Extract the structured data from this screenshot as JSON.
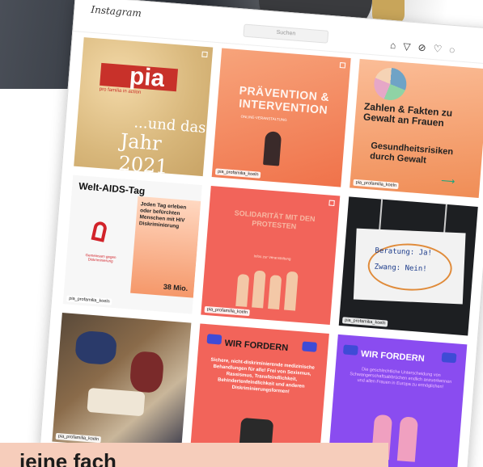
{
  "app": {
    "name": "Instagram",
    "search_placeholder": "Suchen"
  },
  "nav_icons": [
    "home-icon",
    "direct-icon",
    "explore-icon",
    "heart-icon",
    "profile-icon"
  ],
  "bottom_caption": "ieine fach",
  "posts": [
    {
      "lines": [
        "pia",
        "pro familia in action",
        "...und das",
        "Jahr 2021"
      ],
      "tag": ""
    },
    {
      "lines": [
        "PRÄVENTION & INTERVENTION",
        "ONLINE-VERANSTALTUNG"
      ],
      "tag": "pia_profamilia_koeln"
    },
    {
      "lines": [
        "Zahlen & Fakten zu Gewalt an Frauen",
        "Gesundheitsrisiken durch Gewalt"
      ],
      "tag": "pia_profamilia_koeln"
    },
    {
      "lines": [
        "Welt-AIDS-Tag",
        "Jeden Tag erleben oder befürchten Menschen mit HIV Diskriminierung",
        "38 Mio.",
        "Gemeinsam gegen Diskriminierung"
      ],
      "tag": "pia_profamilia_koeln"
    },
    {
      "lines": [
        "SOLIDARITÄT MIT DEN PROTESTEN",
        "Infos zur Veranstaltung"
      ],
      "tag": "pia_profamilia_koeln"
    },
    {
      "lines": [
        "Beratung: Ja!",
        "Zwang: Nein!"
      ],
      "tag": "pia_profamilia_koeln"
    },
    {
      "lines": [],
      "tag": "pia_profamilia_koeln"
    },
    {
      "lines": [
        "WIR FORDERN",
        "Sichere, nicht-diskriminierende medizinische Behandlungen für alle! Frei von Sexismus, Rassismus, Transfeindlichkeit, Behindertenfeindlichkeit und anderen Diskriminierungsformen!"
      ],
      "tag": "pia_profamilia_koeln"
    },
    {
      "lines": [
        "WIR FORDERN",
        "Die geschlechtliche Unterscheidung von Schwangerschaftsabbrüchen endlich anzuerkennen und allen Frauen in Europa zu ermöglichen!"
      ],
      "tag": "pia_profamilia_koeln"
    }
  ]
}
